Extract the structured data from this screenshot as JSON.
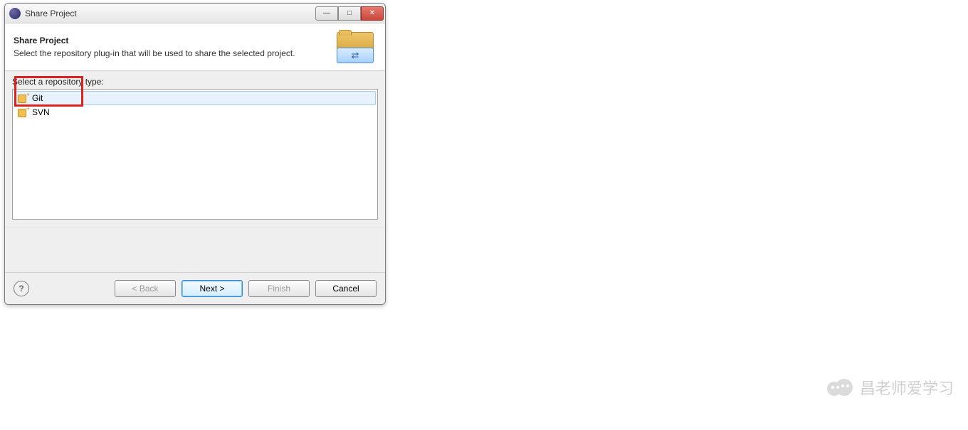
{
  "window": {
    "title": "Share Project"
  },
  "header": {
    "title": "Share Project",
    "description": "Select the repository plug-in that will be used to share the selected project."
  },
  "content": {
    "list_label": "Select a repository type:",
    "repo_types": [
      {
        "label": "Git",
        "selected": true
      },
      {
        "label": "SVN",
        "selected": false
      }
    ]
  },
  "footer": {
    "help_symbol": "?",
    "back_label": "< Back",
    "next_label": "Next >",
    "finish_label": "Finish",
    "cancel_label": "Cancel"
  },
  "watermark": {
    "text": "昌老师爱学习"
  }
}
